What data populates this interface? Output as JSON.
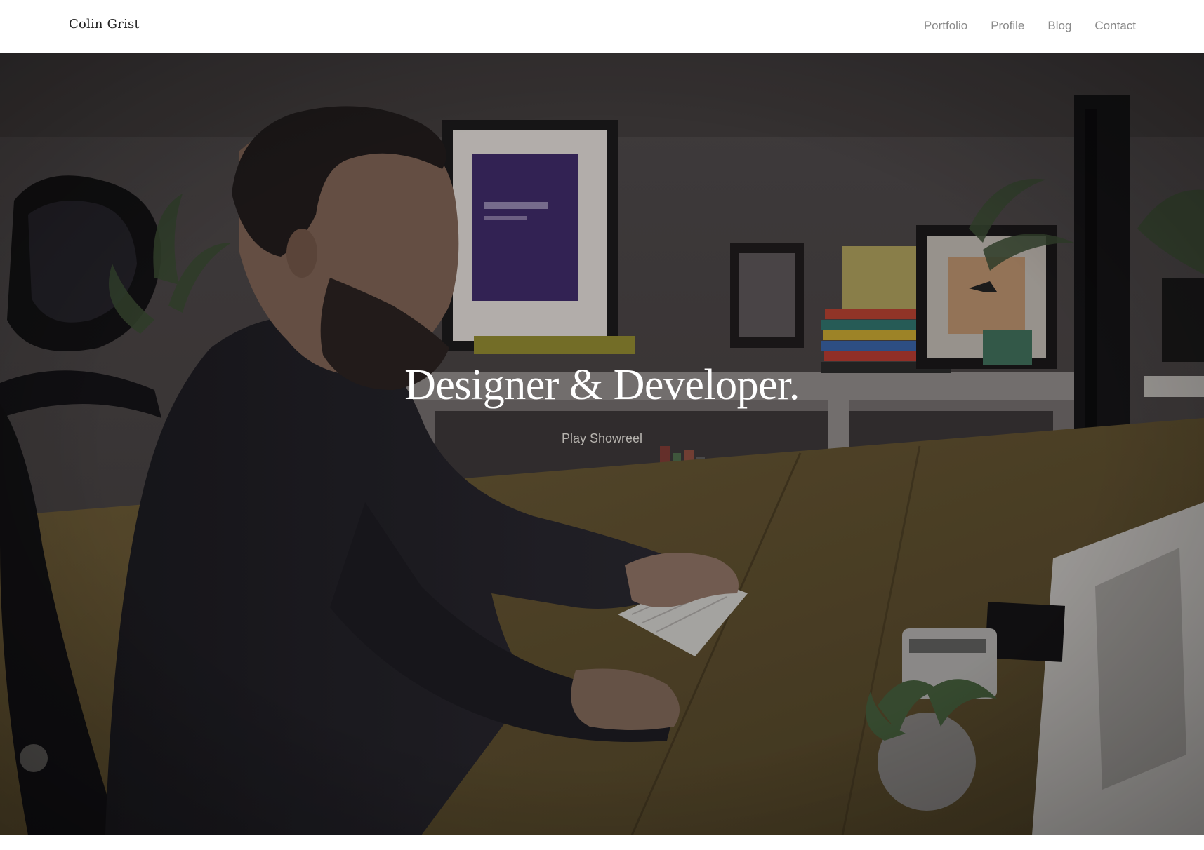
{
  "header": {
    "brand": "Colin Grist",
    "nav": [
      {
        "label": "Portfolio"
      },
      {
        "label": "Profile"
      },
      {
        "label": "Blog"
      },
      {
        "label": "Contact"
      }
    ]
  },
  "hero": {
    "title": "Designer & Developer.",
    "cta_label": "Play Showreel",
    "background_image": "man-at-desk-photo"
  },
  "colors": {
    "nav_text": "#8a8a8a",
    "brand_text": "#222222",
    "hero_title": "#ffffff",
    "hero_link": "#b5b2ad"
  }
}
